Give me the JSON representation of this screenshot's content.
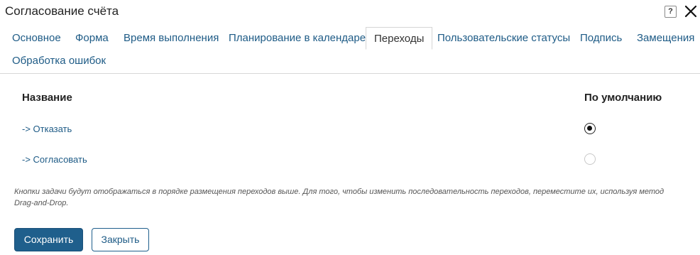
{
  "window": {
    "title": "Согласование счёта"
  },
  "tabs": [
    {
      "label": "Основное"
    },
    {
      "label": "Форма"
    },
    {
      "label": "Время выполнения"
    },
    {
      "label": "Планирование в календаре"
    },
    {
      "label": "Переходы",
      "active": true
    },
    {
      "label": "Пользовательские статусы"
    },
    {
      "label": "Подпись"
    },
    {
      "label": "Замещения"
    },
    {
      "label": "Обработка ошибок"
    }
  ],
  "table": {
    "col_name": "Название",
    "col_default": "По умолчанию",
    "rows": [
      {
        "name": "-> Отказать",
        "is_default": true
      },
      {
        "name": "-> Согласовать",
        "is_default": false
      }
    ]
  },
  "hint": "Кнопки задачи будут отображаться в порядке размещения переходов выше. Для того, чтобы изменить последовательность переходов, переместите их, используя метод Drag-and-Drop.",
  "buttons": {
    "save": "Сохранить",
    "close": "Закрыть"
  },
  "colors": {
    "link": "#1e5b86",
    "primary": "#1f5f8c"
  }
}
